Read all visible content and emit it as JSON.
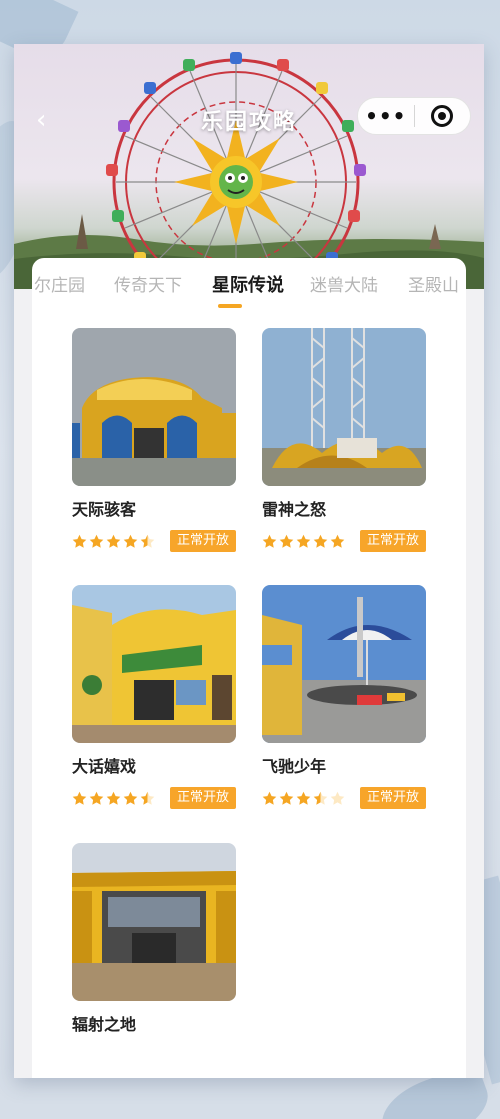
{
  "nav": {
    "title": "乐园攻略",
    "back_icon": "chevron-left-icon",
    "more_icon": "more-dots-icon",
    "close_icon": "target-close-icon"
  },
  "tabs": [
    {
      "label": "尔庄园",
      "active": false
    },
    {
      "label": "传奇天下",
      "active": false
    },
    {
      "label": "星际传说",
      "active": true
    },
    {
      "label": "迷兽大陆",
      "active": false
    },
    {
      "label": "圣殿山",
      "active": false
    }
  ],
  "colors": {
    "accent": "#f5a623",
    "badge": "#f7a52a",
    "star_on": "#f5a623",
    "star_off": "#fde9c4"
  },
  "attractions": [
    {
      "name": "天际骇客",
      "rating": 4.5,
      "status": "正常开放"
    },
    {
      "name": "雷神之怒",
      "rating": 5,
      "status": "正常开放"
    },
    {
      "name": "大话嬉戏",
      "rating": 4.5,
      "status": "正常开放"
    },
    {
      "name": "飞驰少年",
      "rating": 3.5,
      "status": "正常开放"
    },
    {
      "name": "辐射之地",
      "rating": null,
      "status": ""
    }
  ]
}
